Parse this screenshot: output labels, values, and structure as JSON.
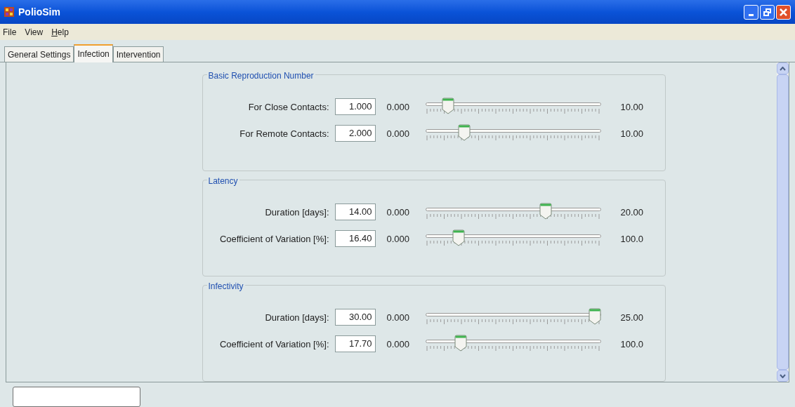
{
  "window": {
    "title": "PolioSim"
  },
  "menu": [
    {
      "label": "File",
      "mnemonic": false
    },
    {
      "label": "View",
      "mnemonic": false
    },
    {
      "label": "Help",
      "mnemonic": true
    }
  ],
  "tabs": [
    {
      "label": "General Settings",
      "selected": false
    },
    {
      "label": "Infection",
      "selected": true
    },
    {
      "label": "Intervention",
      "selected": false
    }
  ],
  "sections": [
    {
      "title": "Basic Reproduction Number",
      "rows": [
        {
          "label": "For Close Contacts:",
          "value": "1.000",
          "min": "0.000",
          "max": "10.00",
          "level": 0.1
        },
        {
          "label": "For Remote Contacts:",
          "value": "2.000",
          "min": "0.000",
          "max": "10.00",
          "level": 0.2
        }
      ]
    },
    {
      "title": "Latency",
      "rows": [
        {
          "label": "Duration [days]:",
          "value": "14.00",
          "min": "0.000",
          "max": "20.00",
          "level": 0.7
        },
        {
          "label": "Coefficient of Variation [%]:",
          "value": "16.40",
          "min": "0.000",
          "max": "100.0",
          "level": 0.164
        }
      ]
    },
    {
      "title": "Infectivity",
      "rows": [
        {
          "label": "Duration [days]:",
          "value": "30.00",
          "min": "0.000",
          "max": "25.00",
          "level": 1.0
        },
        {
          "label": "Coefficient of Variation [%]:",
          "value": "17.70",
          "min": "0.000",
          "max": "100.0",
          "level": 0.177
        }
      ]
    }
  ]
}
